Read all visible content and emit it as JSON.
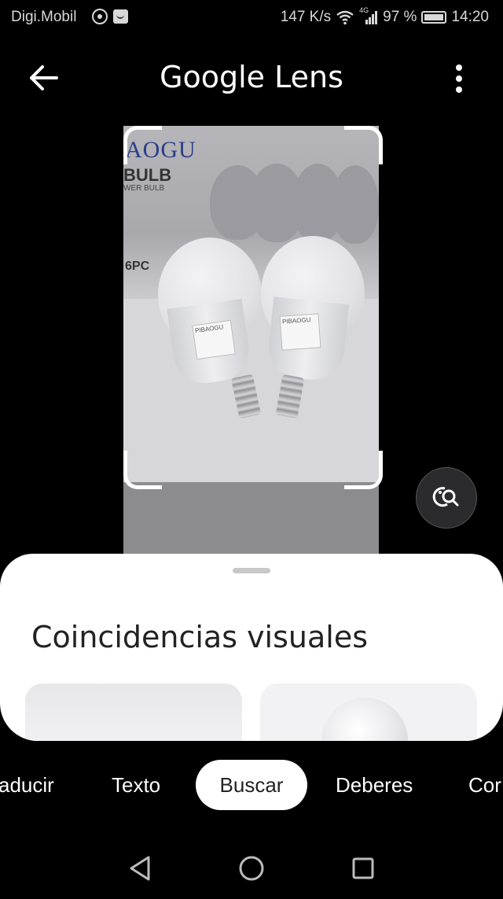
{
  "status_bar": {
    "carrier": "Digi.Mobil",
    "speed": "147 K/s",
    "network": "4G",
    "battery": "97 %",
    "time": "14:20",
    "icons": [
      "whatsapp-icon",
      "message-icon",
      "wifi-icon",
      "signal-icon",
      "battery-icon"
    ]
  },
  "app_bar": {
    "title": "Google Lens",
    "back_icon": "arrow-left-icon",
    "menu_icon": "more-vert-icon"
  },
  "photo": {
    "box_brand": "AOGU",
    "box_text": "BULB",
    "box_subtext": "WER BULB",
    "box_count": "6PC",
    "bulb_label": "PIBAOGU"
  },
  "lens_search_icon": "image-search-icon",
  "sheet": {
    "title": "Coincidencias visuales"
  },
  "tabs": [
    {
      "label": "aducir",
      "active": false
    },
    {
      "label": "Texto",
      "active": false
    },
    {
      "label": "Buscar",
      "active": true
    },
    {
      "label": "Deberes",
      "active": false
    },
    {
      "label": "Cor",
      "active": false
    }
  ],
  "nav_bar": {
    "back": "triangle-back-icon",
    "home": "circle-home-icon",
    "recents": "square-recents-icon"
  }
}
